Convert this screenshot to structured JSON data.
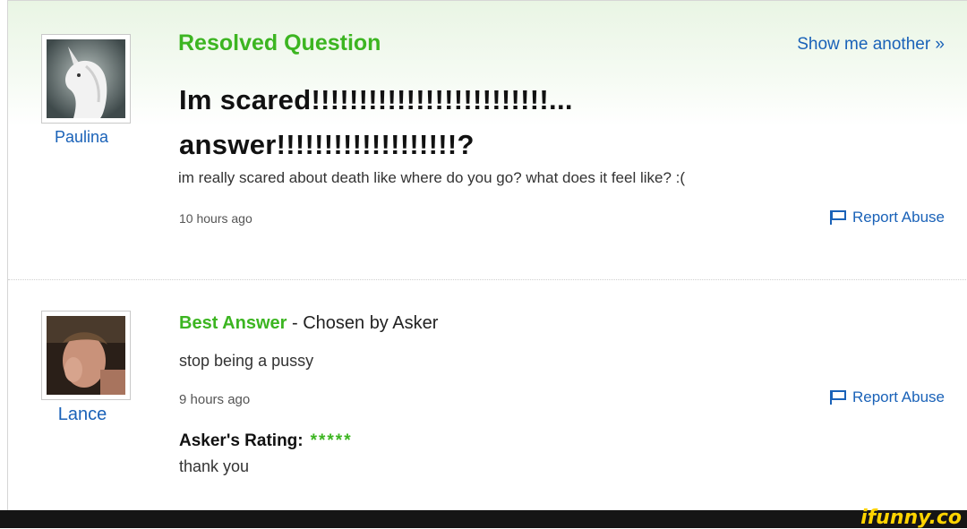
{
  "question": {
    "section_title": "Resolved Question",
    "show_another": "Show me another »",
    "asker_name": "Paulina",
    "title_line1": "Im scared!!!!!!!!!!!!!!!!!!!!!!!!!...",
    "title_line2": "answer!!!!!!!!!!!!!!!!!!!?",
    "body": "im really scared about death like where do you go? what does it feel like? :(",
    "time": "10 hours ago",
    "report_label": "Report Abuse"
  },
  "answer": {
    "best_label": "Best Answer",
    "chosen_by": " - Chosen by Asker",
    "answerer_name": "Lance",
    "text": "stop being a pussy",
    "time": "9 hours ago",
    "report_label": "Report Abuse",
    "rating_label": "Asker's Rating:",
    "stars": "*****",
    "rating_comment": "thank you"
  },
  "watermark": "ifunny.co",
  "colors": {
    "green": "#3cb521",
    "link_blue": "#1a62b8",
    "bar": "#151515",
    "watermark": "#ffd400"
  },
  "icons": [
    "unicorn-avatar",
    "flag-icon",
    "person-avatar"
  ]
}
